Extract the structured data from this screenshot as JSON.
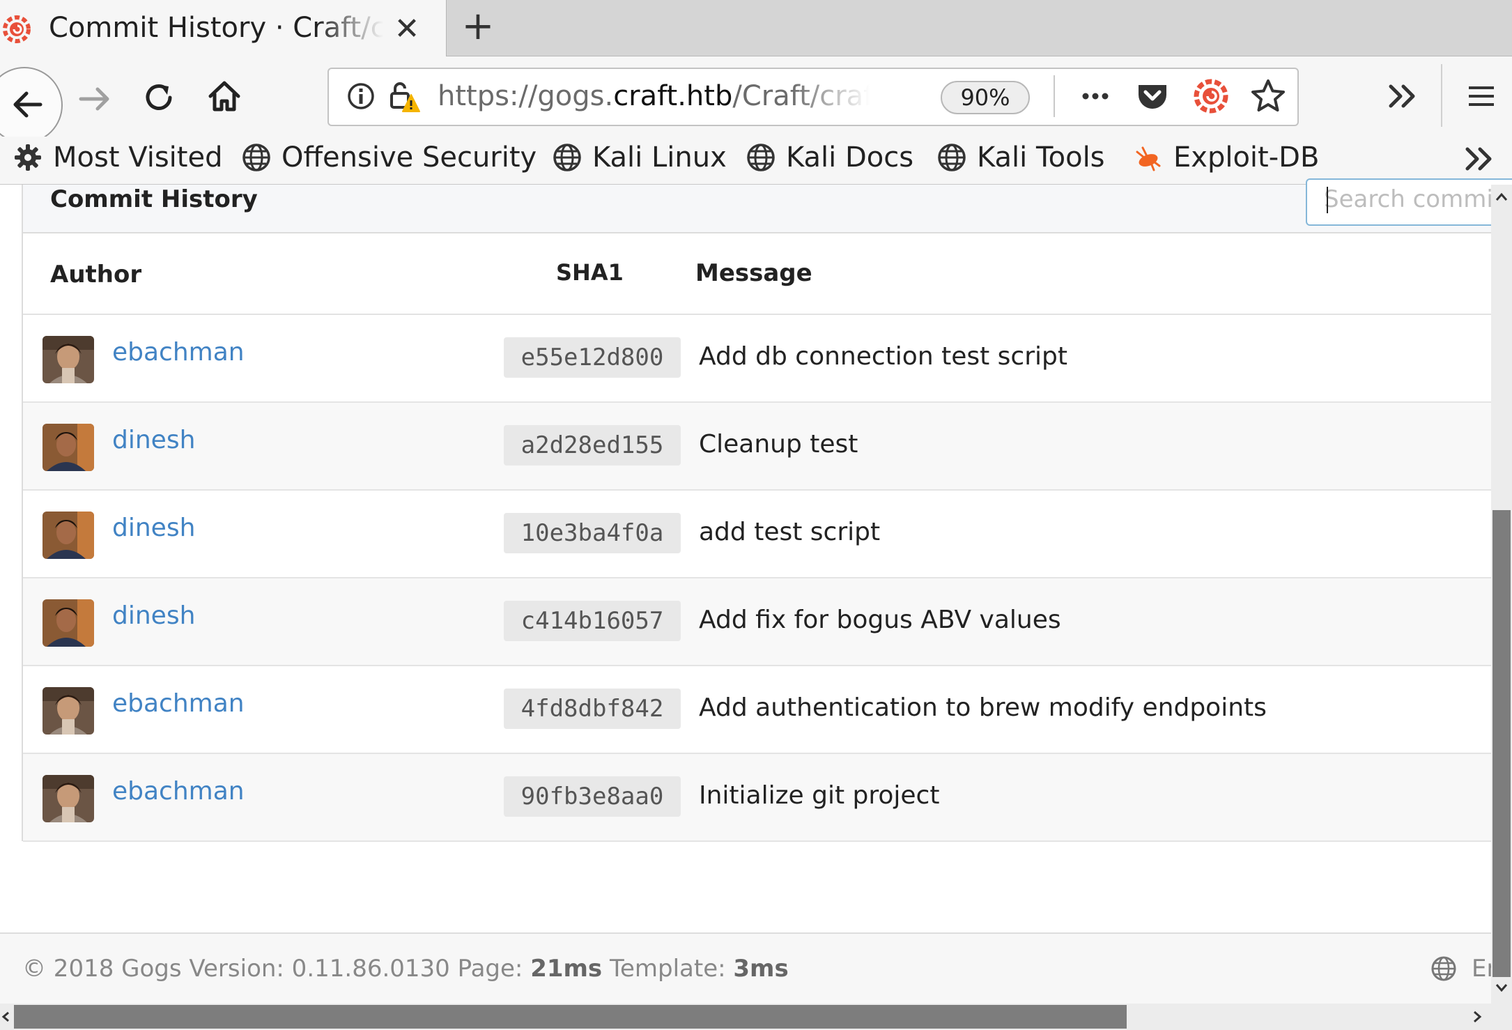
{
  "browser": {
    "tab_title": "Commit History · Craft/craft-api",
    "url_prefix": "https://gogs.",
    "url_host": "craft.htb",
    "url_path": "/Craft/craft-api/commits/master",
    "zoom": "90%"
  },
  "bookmarks": [
    {
      "label": "Most Visited",
      "icon": "gear-icon"
    },
    {
      "label": "Offensive Security",
      "icon": "globe-icon"
    },
    {
      "label": "Kali Linux",
      "icon": "globe-icon"
    },
    {
      "label": "Kali Docs",
      "icon": "globe-icon"
    },
    {
      "label": "Kali Tools",
      "icon": "globe-icon"
    },
    {
      "label": "Exploit-DB",
      "icon": "exploitdb-icon"
    }
  ],
  "commits": {
    "panel_title": "Commit History",
    "search_placeholder": "Search commits",
    "columns": {
      "author": "Author",
      "sha": "SHA1",
      "message": "Message"
    },
    "rows": [
      {
        "author": "ebachman",
        "sha": "e55e12d800",
        "message": "Add db connection test script"
      },
      {
        "author": "dinesh",
        "sha": "a2d28ed155",
        "message": "Cleanup test"
      },
      {
        "author": "dinesh",
        "sha": "10e3ba4f0a",
        "message": "add test script"
      },
      {
        "author": "dinesh",
        "sha": "c414b16057",
        "message": "Add fix for bogus ABV values"
      },
      {
        "author": "ebachman",
        "sha": "4fd8dbf842",
        "message": "Add authentication to brew modify endpoints"
      },
      {
        "author": "ebachman",
        "sha": "90fb3e8aa0",
        "message": "Initialize git project"
      }
    ]
  },
  "footer": {
    "copyright": "© 2018 Gogs Version: 0.11.86.0130 Page: ",
    "page_time": "21ms",
    "template_label": " Template: ",
    "template_time": "3ms",
    "language": "English"
  },
  "colors": {
    "link": "#4183c4",
    "gogs_brand": "#e8503a",
    "accent_focus": "#85b7d9"
  }
}
